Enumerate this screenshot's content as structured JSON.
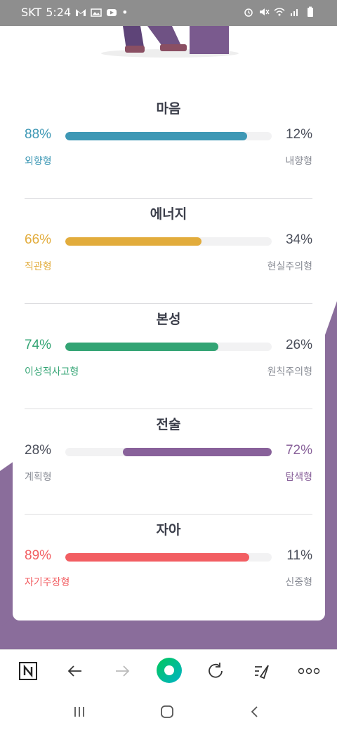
{
  "status_bar": {
    "carrier": "SKT",
    "time": "5:24",
    "dot": "•",
    "left_icons": [
      "gmail-icon",
      "photo-icon",
      "youtube-icon"
    ],
    "right_icons": [
      "alarm-icon",
      "mute-icon",
      "wifi-icon",
      "signal-icon",
      "battery-icon"
    ]
  },
  "results": [
    {
      "title": "마음",
      "left_pct": "88%",
      "right_pct": "12%",
      "left_label": "외향형",
      "right_label": "내향형",
      "fill_fraction": 0.88,
      "fill_side": "left",
      "color": "#3e98b5"
    },
    {
      "title": "에너지",
      "left_pct": "66%",
      "right_pct": "34%",
      "left_label": "직관형",
      "right_label": "현실주의형",
      "fill_fraction": 0.66,
      "fill_side": "left",
      "color": "#e2ac3c"
    },
    {
      "title": "본성",
      "left_pct": "74%",
      "right_pct": "26%",
      "left_label": "이성적사고형",
      "right_label": "원칙주의형",
      "fill_fraction": 0.74,
      "fill_side": "left",
      "color": "#33a474"
    },
    {
      "title": "전술",
      "left_pct": "28%",
      "right_pct": "72%",
      "left_label": "계획형",
      "right_label": "탐색형",
      "fill_fraction": 0.72,
      "fill_side": "right",
      "color": "#88619a"
    },
    {
      "title": "자아",
      "left_pct": "89%",
      "right_pct": "11%",
      "left_label": "자기주장형",
      "right_label": "신중형",
      "fill_fraction": 0.89,
      "fill_side": "left",
      "color": "#f25e62"
    }
  ],
  "colors": {
    "muted_text": "#4a4e5a",
    "muted_label": "#8a8d96",
    "background_purple": "#8a6d9b",
    "accent_green": "#03c75a"
  },
  "toolbar": {
    "icons": [
      "naver-home-icon",
      "back-arrow-icon",
      "forward-arrow-icon",
      "green-circle-icon",
      "refresh-icon",
      "share-icon",
      "more-icon"
    ]
  },
  "navbar": {
    "icons": [
      "recent-apps-icon",
      "home-icon",
      "back-icon"
    ]
  }
}
